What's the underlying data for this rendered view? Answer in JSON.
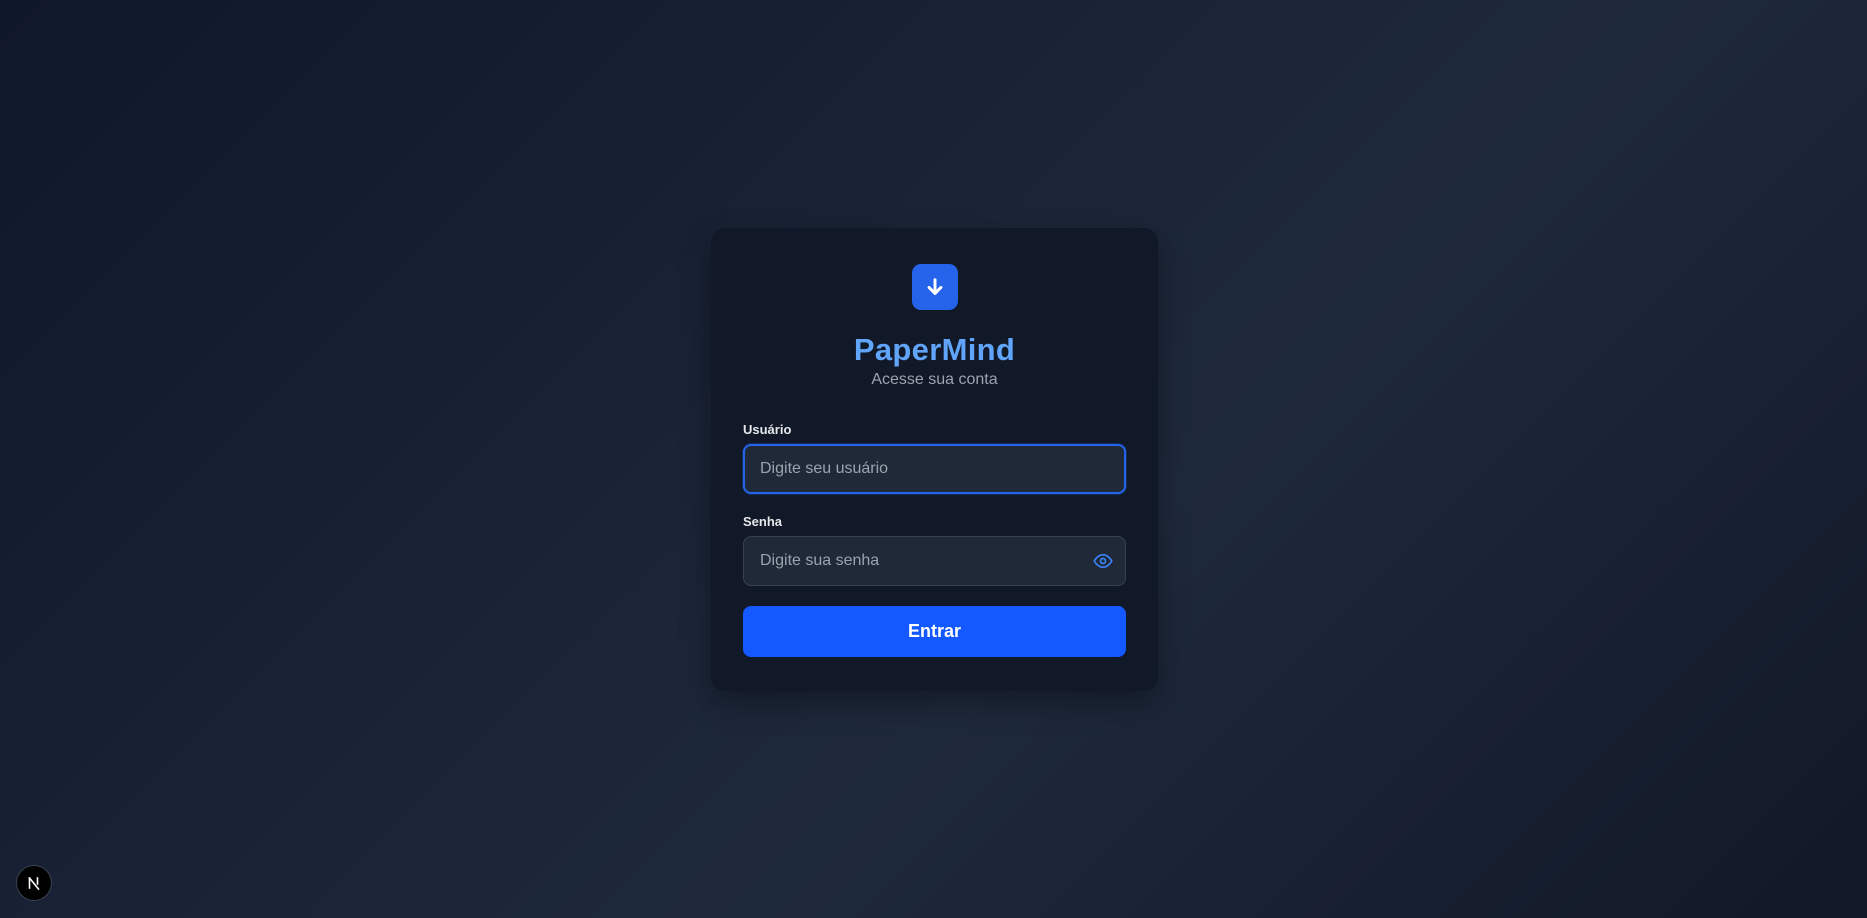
{
  "app": {
    "title": "PaperMind",
    "subtitle": "Acesse sua conta",
    "logo_icon": "arrow-down-icon",
    "accent_color": "#2563eb",
    "title_color": "#60a5fa"
  },
  "form": {
    "username": {
      "label": "Usuário",
      "placeholder": "Digite seu usuário",
      "value": ""
    },
    "password": {
      "label": "Senha",
      "placeholder": "Digite sua senha",
      "value": "",
      "toggle_icon": "eye-icon"
    },
    "submit_label": "Entrar",
    "submit_color": "#1458ff"
  },
  "dev_indicator": {
    "icon": "nextjs-logo-icon"
  }
}
